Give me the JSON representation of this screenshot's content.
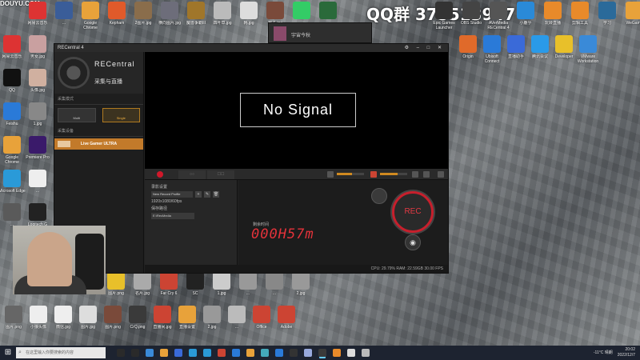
{
  "watermark": {
    "douyu": "DOUYU.COM",
    "qq_group": "QQ群 375513947"
  },
  "desktop_icons_top": [
    {
      "label": "网易云音乐",
      "color": "#d33"
    },
    {
      "label": "...",
      "color": "#3a5d99"
    },
    {
      "label": "Google Chrome",
      "color": "#e8a23a"
    },
    {
      "label": "Kepham",
      "color": "#e05a2a"
    },
    {
      "label": "2图片.jpg",
      "color": "#8a6d4b"
    },
    {
      "label": "横向图片.jpg",
      "color": "#6d6d7a"
    },
    {
      "label": "魔兽争霸III",
      "color": "#a0762a"
    },
    {
      "label": "四叶草.jpg",
      "color": "#bbb"
    },
    {
      "label": "韩.jpg",
      "color": "#ddd"
    },
    {
      "label": "猴子.jpg",
      "color": "#7a4a3a"
    },
    {
      "label": "...",
      "color": "#3c6"
    },
    {
      "label": "...",
      "color": "#2a6a3a"
    }
  ],
  "desktop_icons_top_right": [
    {
      "label": "Epic Games Launcher",
      "color": "#333"
    },
    {
      "label": "OBS Studio",
      "color": "#444"
    },
    {
      "label": "AVerMedia RECentral 4",
      "color": "#555"
    },
    {
      "label": "小鹿乎",
      "color": "#2a8ad8"
    },
    {
      "label": "玩转直播",
      "color": "#e88a2a"
    },
    {
      "label": "剪辑工具",
      "color": "#e88a2a"
    },
    {
      "label": "学习",
      "color": "#2a6a9a"
    },
    {
      "label": "WeGame",
      "color": "#e8a23a"
    }
  ],
  "desktop_icons_row2_right": [
    {
      "label": "Origin",
      "color": "#e06a2a"
    },
    {
      "label": "Ubisoft Connect",
      "color": "#2a7ad8"
    },
    {
      "label": "直播助手",
      "color": "#3a6ad8"
    },
    {
      "label": "腾讯会议",
      "color": "#2a9ae8"
    },
    {
      "label": "Developer",
      "color": "#e8c02a"
    },
    {
      "label": "VMware Workstation",
      "color": "#3a8ad8"
    }
  ],
  "desktop_icons_left": [
    {
      "label": "网易云音乐",
      "color": "#d33"
    },
    {
      "label": "QQ",
      "color": "#111"
    },
    {
      "label": "Feishu",
      "color": "#2a7ad8"
    },
    {
      "label": "Google Chrome",
      "color": "#e8a23a"
    },
    {
      "label": "Microsoft Edge",
      "color": "#2a9ad8"
    },
    {
      "label": "...",
      "color": "#5a5a5a"
    }
  ],
  "desktop_icons_col2_left": [
    {
      "label": "男女.jpg",
      "color": "#c9a0a0"
    },
    {
      "label": "头像.jpg",
      "color": "#d0b0a0"
    },
    {
      "label": "1.jpg",
      "color": "#888"
    },
    {
      "label": "Premiere Pro",
      "color": "#3a1a6a"
    },
    {
      "label": "...",
      "color": "#eee"
    },
    {
      "label": "Logitech G",
      "color": "#222"
    }
  ],
  "desktop_icons_bottom": [
    {
      "label": "图片.png",
      "color": "#e8c02a"
    },
    {
      "label": "名片.jpg",
      "color": "#aaa"
    },
    {
      "label": "Far Cry 6",
      "color": "#c43"
    },
    {
      "label": "SC",
      "color": "#222"
    },
    {
      "label": "1.jpg",
      "color": "#ccc"
    },
    {
      "label": "...",
      "color": "#999"
    },
    {
      "label": "...",
      "color": "#888"
    },
    {
      "label": "2.jpg",
      "color": "#999"
    }
  ],
  "desktop_icons_bottom2": [
    {
      "label": "图片.png",
      "color": "#666"
    },
    {
      "label": "小狼头像",
      "color": "#eee"
    },
    {
      "label": "微信.jpg",
      "color": "#eee"
    },
    {
      "label": "图片.jpg",
      "color": "#ddd"
    },
    {
      "label": "图片.png",
      "color": "#7a4a3a"
    },
    {
      "label": "CrQ.png",
      "color": "#3a3a3a"
    },
    {
      "label": "直播间.jpg",
      "color": "#c43"
    },
    {
      "label": "直播设置",
      "color": "#e8a23a"
    },
    {
      "label": "2.jpg",
      "color": "#999"
    },
    {
      "label": "...",
      "color": "#bbb"
    },
    {
      "label": "Office",
      "color": "#c43"
    },
    {
      "label": "Adobe",
      "color": "#c43"
    }
  ],
  "mini_window": {
    "title": "宇宙今秋"
  },
  "app": {
    "window_title": "RECentral 4",
    "brand": "RECentral",
    "brand_sub": "采集与直播",
    "mode_section": "采集模式",
    "modes": [
      {
        "label": "Multi"
      },
      {
        "label": "Single"
      }
    ],
    "device_section": "采集设备",
    "device_name": "Live Gamer ULTRA",
    "preview_text": "No Signal",
    "tabs": [
      "○○",
      "☐☐"
    ],
    "settings": {
      "profile_label": "录影设置",
      "profile_value": "New Record Profile",
      "profile_sub": "1920x1080/60fps",
      "path_label": "保存路径",
      "path_value": "E:\\RecMedia"
    },
    "rec": {
      "time_label": "剩余时间",
      "timer": "000H57m",
      "rec_label": "REC",
      "snapshot_icon": "camera-icon"
    },
    "status": "CPU: 29.79%  RAM: 22.59GB  30.00 FPS",
    "audio_in_level": 0.55,
    "audio_out_level": 0.65
  },
  "taskbar": {
    "search_placeholder": "在这里输入你要搜索的内容",
    "icons": [
      "#2a2a2a",
      "#2a2a2a",
      "#3a8ad8",
      "#e8a23a",
      "#3a6ad8",
      "#2a9ad8",
      "#2a9ad8",
      "#c43",
      "#2a7ad8",
      "#e8a23a",
      "#4ab",
      "#2a7ad8",
      "#333",
      "#9ad",
      "#3a3a3a",
      "#e88a2a",
      "#ddd",
      "#bbb"
    ],
    "weather": "-11°C 晴朗",
    "time": "20:02",
    "date": "2022/12/7"
  }
}
